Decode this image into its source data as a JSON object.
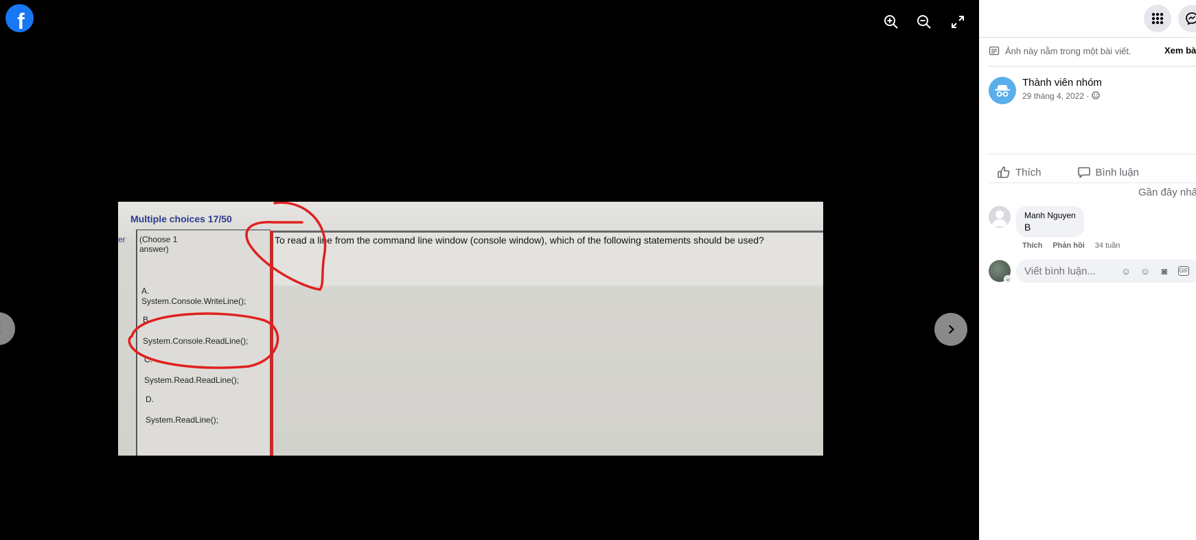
{
  "viewer": {
    "photo": {
      "title": "Multiple choices 17/50",
      "choose_label_1": "(Choose 1",
      "choose_label_2": "answer)",
      "question": "To read a line from the command line window (console window), which of the following statements should be used?",
      "options": [
        {
          "letter": "A.",
          "text": "System.Console.WriteLine();"
        },
        {
          "letter": "B.",
          "text": "System.Console.ReadLine();"
        },
        {
          "letter": "C.",
          "text": "System.Read.ReadLine();"
        },
        {
          "letter": "D.",
          "text": "System.ReadLine();"
        }
      ],
      "left_edge_char": "er"
    },
    "icons": {
      "logo": "facebook-logo",
      "zoom_in": "zoom-in-icon",
      "zoom_out": "zoom-out-icon",
      "fullscreen": "fullscreen-icon",
      "next": "chevron-right-icon",
      "prev": "chevron-left-icon"
    },
    "logo_letter": "f"
  },
  "sidebar": {
    "post_note": "Ảnh này nằm trong một bài viết.",
    "view_post": "Xem bài",
    "author": {
      "name": "Thành viên nhóm",
      "date": "29 tháng 4, 2022 · "
    },
    "actions": {
      "like": "Thích",
      "comment": "Bình luận"
    },
    "sort_label": "Gần đây nhấ",
    "comments": [
      {
        "name": "Manh Nguyen",
        "text": "B",
        "like": "Thích",
        "reply": "Phản hồi",
        "time": "34 tuần"
      }
    ],
    "composer_placeholder": "Viết bình luận..."
  },
  "colors": {
    "brand": "#1877f2",
    "red_mark": "#e02020",
    "secondary_text": "#65676b"
  }
}
